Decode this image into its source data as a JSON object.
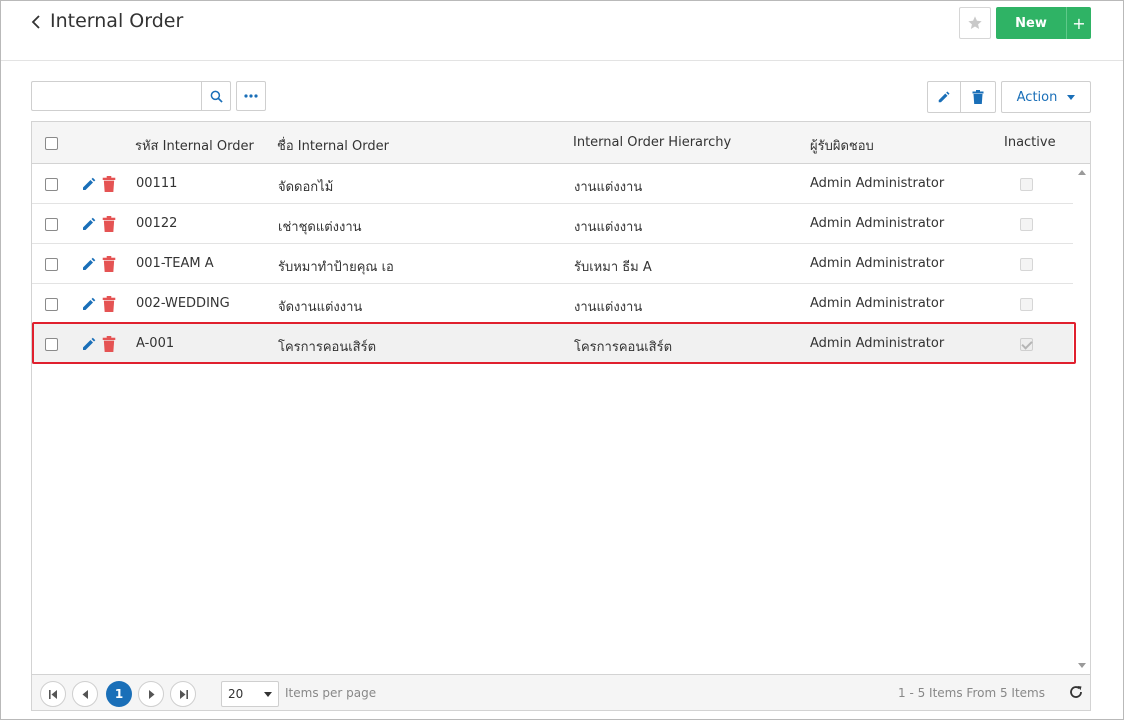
{
  "header": {
    "title": "Internal Order",
    "new_label": "New",
    "plus_label": "+"
  },
  "toolbar": {
    "search_placeholder": "",
    "search_value": "",
    "action_label": "Action"
  },
  "table": {
    "columns": {
      "code": "รหัส Internal Order",
      "name": "ชื่อ Internal Order",
      "hierarchy": "Internal Order Hierarchy",
      "owner": "ผู้รับผิดชอบ",
      "inactive": "Inactive"
    },
    "rows": [
      {
        "code": "00111",
        "name": "จัดดอกไม้",
        "hierarchy": "งานแต่งงาน",
        "owner": "Admin Administrator",
        "inactive": false
      },
      {
        "code": "00122",
        "name": "เช่าชุดแต่งงาน",
        "hierarchy": "งานแต่งงาน",
        "owner": "Admin Administrator",
        "inactive": false
      },
      {
        "code": "001-TEAM A",
        "name": "รับหมาทำป้ายคุณ เอ",
        "hierarchy": "รับเหมา ธีม A",
        "owner": "Admin Administrator",
        "inactive": false
      },
      {
        "code": "002-WEDDING",
        "name": "จัดงานแต่งงาน",
        "hierarchy": "งานแต่งงาน",
        "owner": "Admin Administrator",
        "inactive": false
      },
      {
        "code": "A-001",
        "name": "โครการคอนเสิร์ต",
        "hierarchy": "โครการคอนเสิร์ต",
        "owner": "Admin Administrator",
        "inactive": true
      }
    ]
  },
  "pager": {
    "current_page": "1",
    "page_size": "20",
    "items_per_page_label": "Items per page",
    "info": "1 - 5 Items From 5 Items"
  },
  "colors": {
    "primary": "#1a6fb8",
    "success": "#2fb365",
    "danger": "#e0202e",
    "delete_icon": "#e55353"
  }
}
